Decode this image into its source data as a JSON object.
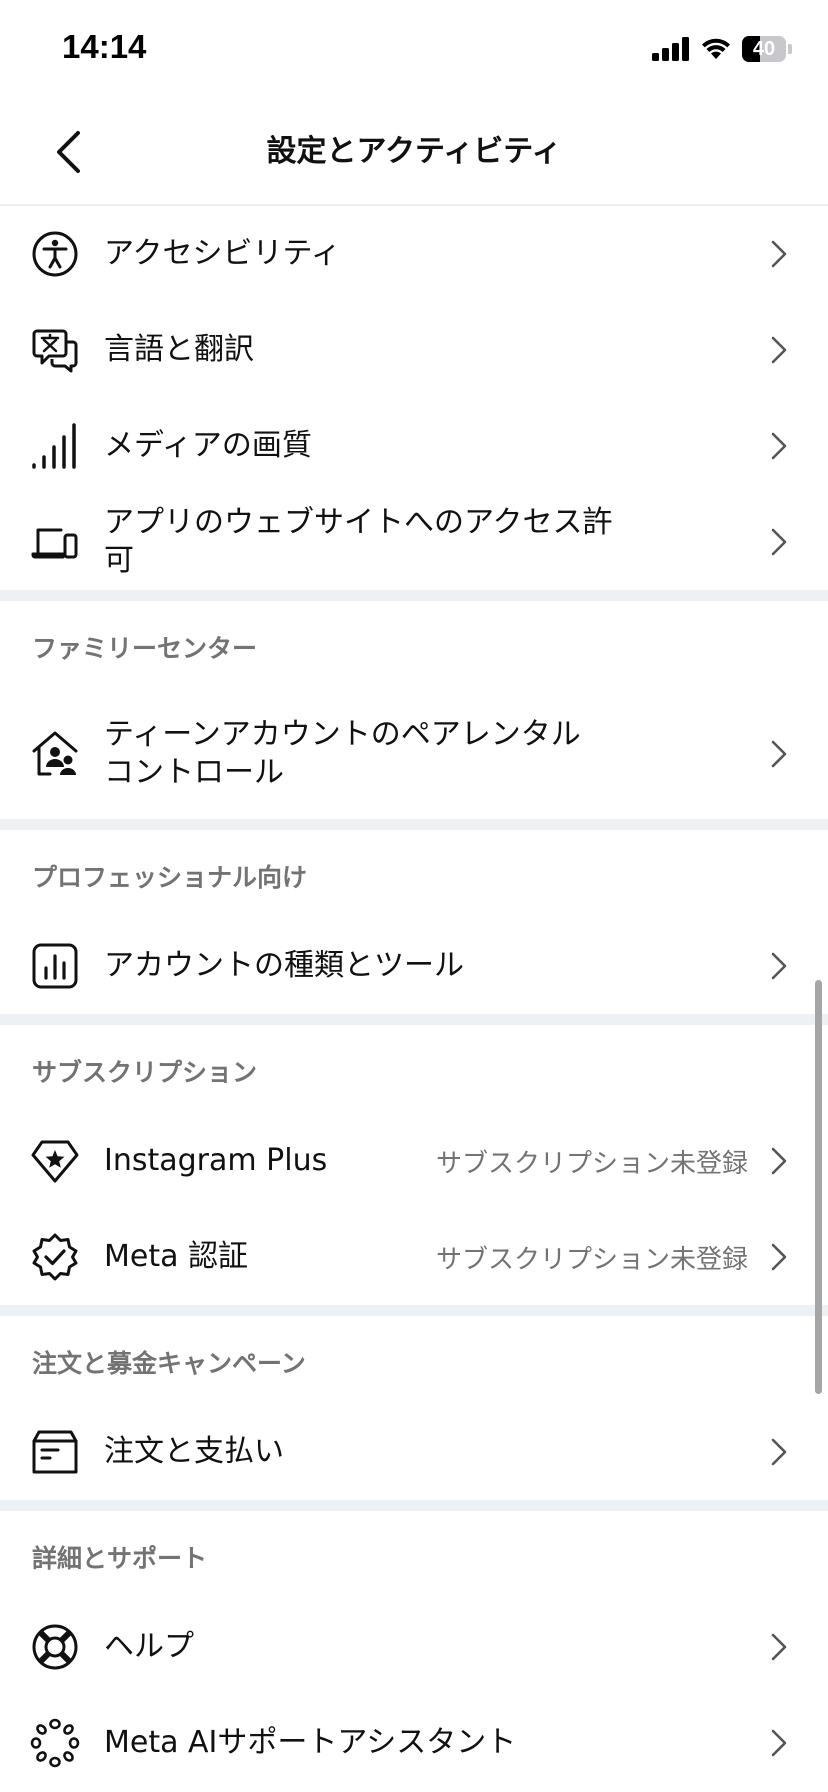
{
  "status_bar": {
    "time": "14:14",
    "battery": 40
  },
  "header": {
    "title": "設定とアクティビティ"
  },
  "rows_top": [
    {
      "label": "アクセシビリティ",
      "icon": "accessibility-icon"
    },
    {
      "label": "言語と翻訳",
      "icon": "language-translate-icon"
    },
    {
      "label": "メディアの画質",
      "icon": "signal-bars-icon"
    },
    {
      "label": "アプリのウェブサイトへのアクセス許可",
      "icon": "devices-icon"
    }
  ],
  "family_center": {
    "header": "ファミリーセンター",
    "row": {
      "label": "ティーンアカウントのペアレンタル",
      "label_line2": "コントロール",
      "icon": "family-home-icon"
    }
  },
  "professional": {
    "header": "プロフェッショナル向け",
    "row": {
      "label": "アカウントの種類とツール",
      "icon": "insights-chart-icon"
    }
  },
  "subscriptions": {
    "header": "サブスクリプション",
    "rows": [
      {
        "label": "Instagram Plus",
        "status": "サブスクリプション未登録",
        "icon": "star-badge-icon"
      },
      {
        "label": "Meta 認証",
        "status": "サブスクリプション未登録",
        "icon": "verified-badge-icon"
      }
    ]
  },
  "orders": {
    "header": "注文と募金キャンペーン",
    "row": {
      "label": "注文と支払い",
      "icon": "receipt-box-icon"
    }
  },
  "support": {
    "header": "詳細とサポート",
    "rows": [
      {
        "label": "ヘルプ",
        "icon": "lifebuoy-icon"
      },
      {
        "label": "Meta AIサポートアシスタント",
        "icon": "meta-ai-icon"
      }
    ]
  }
}
